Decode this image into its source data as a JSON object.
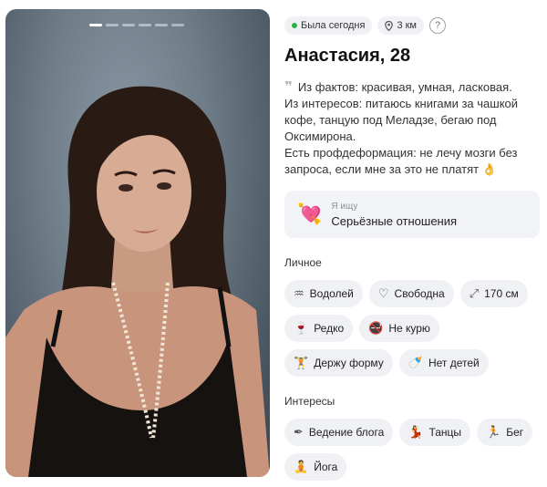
{
  "photo": {
    "alt": "profile photo",
    "pages": 6,
    "current": 0
  },
  "status": {
    "online": "Была сегодня",
    "distance": "3 км",
    "help": "?"
  },
  "profile": {
    "name": "Анастасия, 28",
    "bio": "Из фактов: красивая, умная, ласковая.\nИз интересов: питаюсь книгами за чашкой кофе, танцую под Меладзе, бегаю под Оксимирона.\nЕсть профдеформация: не лечу мозги без запроса, если мне за это не платят 👌"
  },
  "seeking": {
    "label": "Я ищу",
    "value": "Серьёзные отношения",
    "icon": "heart-arrow-icon"
  },
  "personal": {
    "title": "Личное",
    "chips": [
      {
        "label": "Водолей",
        "icon": "aquarius-icon"
      },
      {
        "label": "Свободна",
        "icon": "heart-outline-icon"
      },
      {
        "label": "170 см",
        "icon": "height-icon"
      },
      {
        "label": "Редко",
        "icon": "wine-glass-icon"
      },
      {
        "label": "Не курю",
        "icon": "no-smoking-icon"
      },
      {
        "label": "Держу форму",
        "icon": "dumbbell-icon"
      },
      {
        "label": "Нет детей",
        "icon": "baby-bottle-icon"
      }
    ]
  },
  "interests": {
    "title": "Интересы",
    "chips": [
      {
        "label": "Ведение блога",
        "icon": "pen-icon"
      },
      {
        "label": "Танцы",
        "icon": "dancer-icon"
      },
      {
        "label": "Бег",
        "icon": "runner-icon"
      },
      {
        "label": "Йога",
        "icon": "yoga-icon"
      }
    ]
  },
  "colors": {
    "online": "#2bb34b",
    "chip_bg": "#f0f1f4"
  }
}
